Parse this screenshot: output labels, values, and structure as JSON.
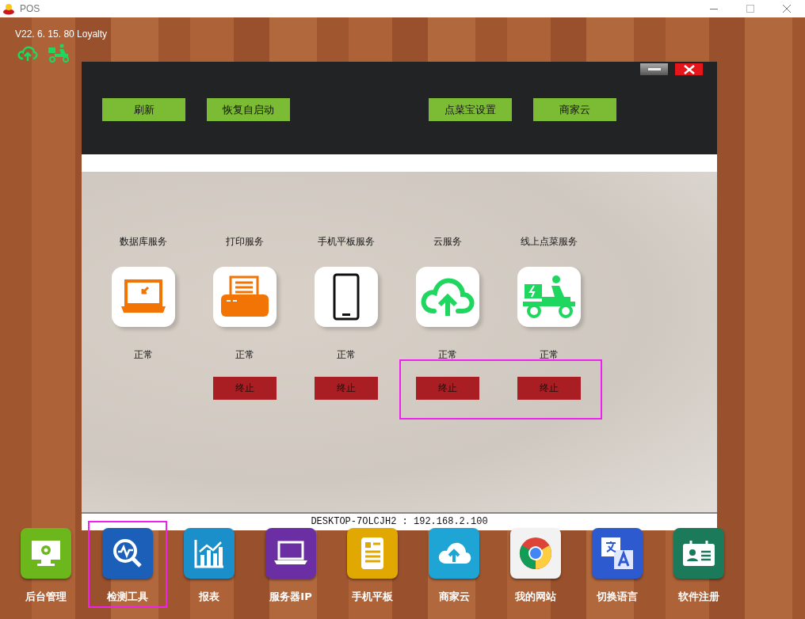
{
  "window": {
    "title": "POS"
  },
  "version": "V22. 6. 15. 80 Loyalty",
  "dialog": {
    "left_buttons": [
      "刷新",
      "恢复自启动"
    ],
    "right_buttons": [
      "点菜宝设置",
      "商家云"
    ],
    "services": [
      {
        "kind": "laptop",
        "name": "数据库服务",
        "status": "正常",
        "highlighted": false
      },
      {
        "kind": "printer",
        "name": "打印服务",
        "status": "正常",
        "stop_button": "终止",
        "highlighted": false
      },
      {
        "kind": "phone",
        "name": "手机平板服务",
        "status": "正常",
        "stop_button": "终止",
        "highlighted": false
      },
      {
        "kind": "cloud",
        "name": "云服务",
        "status": "正常",
        "stop_button": "终止",
        "highlighted": true
      },
      {
        "kind": "delivery",
        "name": "线上点菜服务",
        "status": "正常",
        "stop_button": "终止",
        "highlighted": true
      }
    ],
    "status_bar": "DESKTOP-7OLCJH2 : 192.168.2.100"
  },
  "dock": [
    {
      "kind": "monitor",
      "label": "后台管理",
      "color": "#6cb81c",
      "highlighted": false
    },
    {
      "kind": "monitor-search",
      "label": "检测工具",
      "color": "#1b5fb8",
      "highlighted": true
    },
    {
      "kind": "chart",
      "label": "报表",
      "color": "#1a8fc9",
      "highlighted": false
    },
    {
      "kind": "laptop",
      "label": "服务器IP",
      "color": "#6b2fa3",
      "highlighted": false
    },
    {
      "kind": "tablet",
      "label": "手机平板",
      "color": "#e0a800",
      "highlighted": false
    },
    {
      "kind": "cloud",
      "label": "商家云",
      "color": "#1ea5d6",
      "highlighted": false
    },
    {
      "kind": "browser",
      "label": "我的网站",
      "color": "#f2f2f2",
      "highlighted": false
    },
    {
      "kind": "translate",
      "label": "切换语言",
      "color": "#2e5ad0",
      "highlighted": false
    },
    {
      "kind": "id-card",
      "label": "软件注册",
      "color": "#1a7a5a",
      "highlighted": false
    }
  ]
}
